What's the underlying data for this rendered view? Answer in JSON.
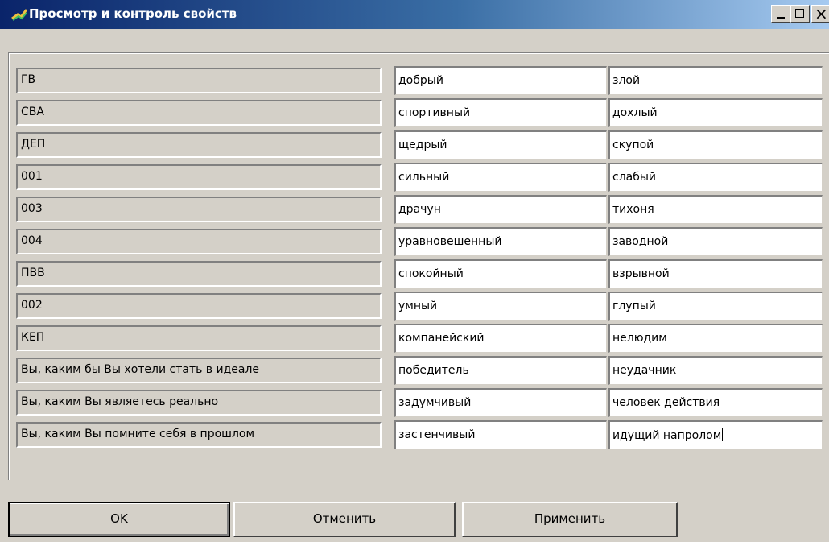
{
  "window": {
    "title": "Просмотр и контроль свойств",
    "icon": "app-icon"
  },
  "title_controls": {
    "minimize": "minimize-icon",
    "maximize": "maximize-icon",
    "close": "close-icon",
    "close_glyph": "×"
  },
  "rows": [
    {
      "label": "ГВ",
      "positive": "добрый",
      "negative": "злой"
    },
    {
      "label": "СВА",
      "positive": "спортивный",
      "negative": "дохлый"
    },
    {
      "label": "ДЕП",
      "positive": "щедрый",
      "negative": "скупой"
    },
    {
      "label": "001",
      "positive": "сильный",
      "negative": "слабый"
    },
    {
      "label": "003",
      "positive": "драчун",
      "negative": "тихоня"
    },
    {
      "label": "004",
      "positive": "уравновешенный",
      "negative": "заводной"
    },
    {
      "label": "ПВВ",
      "positive": "спокойный",
      "negative": "взрывной"
    },
    {
      "label": "002",
      "positive": "умный",
      "negative": "глупый"
    },
    {
      "label": "КЕП",
      "positive": "компанейский",
      "negative": "нелюдим"
    },
    {
      "label": "Вы, каким бы Вы хотели стать в идеале",
      "positive": "победитель",
      "negative": "неудачник"
    },
    {
      "label": "Вы, каким Вы являетесь реально",
      "positive": "задумчивый",
      "negative": "человек действия"
    },
    {
      "label": "Вы, каким Вы помните себя в прошлом",
      "positive": "застенчивый",
      "negative": "идущий напролом"
    }
  ],
  "buttons": {
    "ok": "OK",
    "cancel": "Отменить",
    "apply": "Применить"
  }
}
